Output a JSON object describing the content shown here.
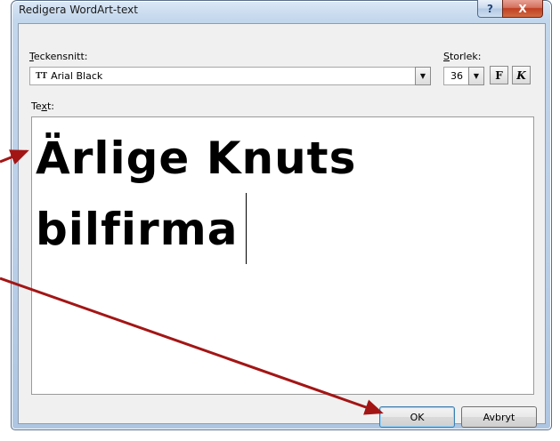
{
  "window": {
    "title": "Redigera WordArt-text",
    "help_label": "?",
    "close_label": "X"
  },
  "font": {
    "label_accesskey": "T",
    "label_rest": "eckensnitt:",
    "value": "Arial Black"
  },
  "size": {
    "label_accesskey": "S",
    "label_rest": "torlek:",
    "value": "36"
  },
  "format_buttons": {
    "bold_label": "F",
    "italic_label": "K"
  },
  "text_area": {
    "label_before": "Te",
    "label_accesskey": "x",
    "label_after": "t:",
    "line1": "Ärlige Knuts",
    "line2": "bilfirma"
  },
  "buttons": {
    "ok_label": "OK",
    "cancel_label": "Avbryt"
  },
  "colors": {
    "annotation_arrow": "#a31515"
  }
}
